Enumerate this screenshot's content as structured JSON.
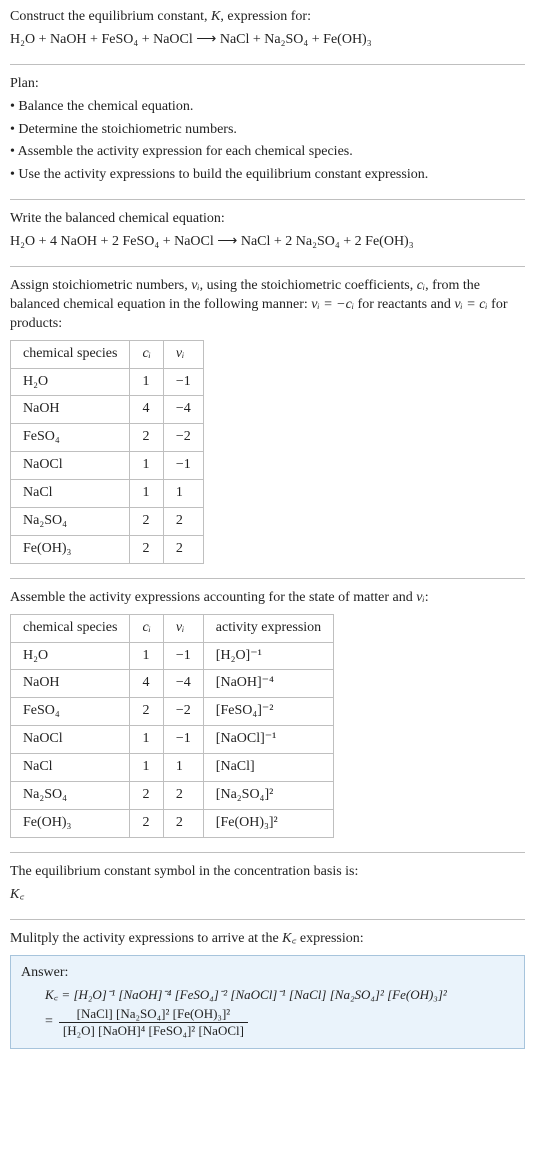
{
  "intro": {
    "line1": "Construct the equilibrium constant, K, expression for:",
    "equation": "H₂O + NaOH + FeSO₄ + NaOCl ⟶ NaCl + Na₂SO₄ + Fe(OH)₃"
  },
  "plan": {
    "title": "Plan:",
    "items": [
      "• Balance the chemical equation.",
      "• Determine the stoichiometric numbers.",
      "• Assemble the activity expression for each chemical species.",
      "• Use the activity expressions to build the equilibrium constant expression."
    ]
  },
  "balanced": {
    "title": "Write the balanced chemical equation:",
    "equation": "H₂O + 4 NaOH + 2 FeSO₄ + NaOCl ⟶ NaCl + 2 Na₂SO₄ + 2 Fe(OH)₃"
  },
  "stoich": {
    "intro_pre": "Assign stoichiometric numbers, ",
    "nui": "νᵢ",
    "intro_mid1": ", using the stoichiometric coefficients, ",
    "ci": "cᵢ",
    "intro_mid2": ", from the balanced chemical equation in the following manner: ",
    "rule1": "νᵢ = −cᵢ",
    "intro_mid3": " for reactants and ",
    "rule2": "νᵢ = cᵢ",
    "intro_mid4": " for products:",
    "headers": [
      "chemical species",
      "cᵢ",
      "νᵢ"
    ],
    "rows": [
      [
        "H₂O",
        "1",
        "−1"
      ],
      [
        "NaOH",
        "4",
        "−4"
      ],
      [
        "FeSO₄",
        "2",
        "−2"
      ],
      [
        "NaOCl",
        "1",
        "−1"
      ],
      [
        "NaCl",
        "1",
        "1"
      ],
      [
        "Na₂SO₄",
        "2",
        "2"
      ],
      [
        "Fe(OH)₃",
        "2",
        "2"
      ]
    ]
  },
  "activity": {
    "intro_pre": "Assemble the activity expressions accounting for the state of matter and ",
    "nui": "νᵢ",
    "intro_post": ":",
    "headers": [
      "chemical species",
      "cᵢ",
      "νᵢ",
      "activity expression"
    ],
    "rows": [
      [
        "H₂O",
        "1",
        "−1",
        "[H₂O]⁻¹"
      ],
      [
        "NaOH",
        "4",
        "−4",
        "[NaOH]⁻⁴"
      ],
      [
        "FeSO₄",
        "2",
        "−2",
        "[FeSO₄]⁻²"
      ],
      [
        "NaOCl",
        "1",
        "−1",
        "[NaOCl]⁻¹"
      ],
      [
        "NaCl",
        "1",
        "1",
        "[NaCl]"
      ],
      [
        "Na₂SO₄",
        "2",
        "2",
        "[Na₂SO₄]²"
      ],
      [
        "Fe(OH)₃",
        "2",
        "2",
        "[Fe(OH)₃]²"
      ]
    ]
  },
  "basis": {
    "line1": "The equilibrium constant symbol in the concentration basis is:",
    "symbol": "K꜀"
  },
  "multiply": {
    "text_pre": "Mulitply the activity expressions to arrive at the ",
    "kc": "K꜀",
    "text_post": " expression:"
  },
  "answer": {
    "label": "Answer:",
    "line1": "K꜀ = [H₂O]⁻¹ [NaOH]⁻⁴ [FeSO₄]⁻² [NaOCl]⁻¹ [NaCl] [Na₂SO₄]² [Fe(OH)₃]²",
    "eq": "=",
    "numerator": "[NaCl] [Na₂SO₄]² [Fe(OH)₃]²",
    "denominator": "[H₂O] [NaOH]⁴ [FeSO₄]² [NaOCl]"
  }
}
